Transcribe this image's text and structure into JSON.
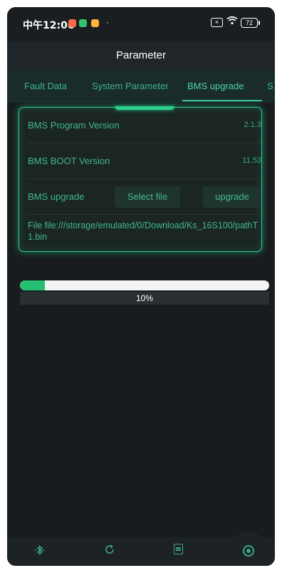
{
  "status_bar": {
    "time": "中午12:06",
    "bullet": "·",
    "sim_icon": "sim-x-icon",
    "wifi_icon": "wifi-icon",
    "battery": "72"
  },
  "header": {
    "title": "Parameter"
  },
  "tabs": [
    {
      "label": "Fault Data"
    },
    {
      "label": "System Parameter"
    },
    {
      "label": "BMS upgrade",
      "active": true
    },
    {
      "label": "S"
    }
  ],
  "card": {
    "rows": [
      {
        "label": "BMS Program Version",
        "value": "2.1.3"
      },
      {
        "label": "BMS BOOT Version",
        "value": "11.53"
      }
    ],
    "upgrade_row": {
      "label": "BMS upgrade",
      "select_button": "Select file",
      "upgrade_button": "upgrade"
    },
    "file_text": "File file:///storage/emulated/0/Download/Ks_16S100/pathT1.bin"
  },
  "progress": {
    "value": 0.1,
    "label": "10%"
  },
  "bottom_nav": [
    {
      "icon": "bluetooth-icon"
    },
    {
      "icon": "sync-icon"
    },
    {
      "icon": "document-icon"
    },
    {
      "icon": "settings-icon"
    }
  ],
  "colors": {
    "accent": "#3fc99a",
    "progress_fill": "#27c072",
    "background": "#181c1f"
  }
}
